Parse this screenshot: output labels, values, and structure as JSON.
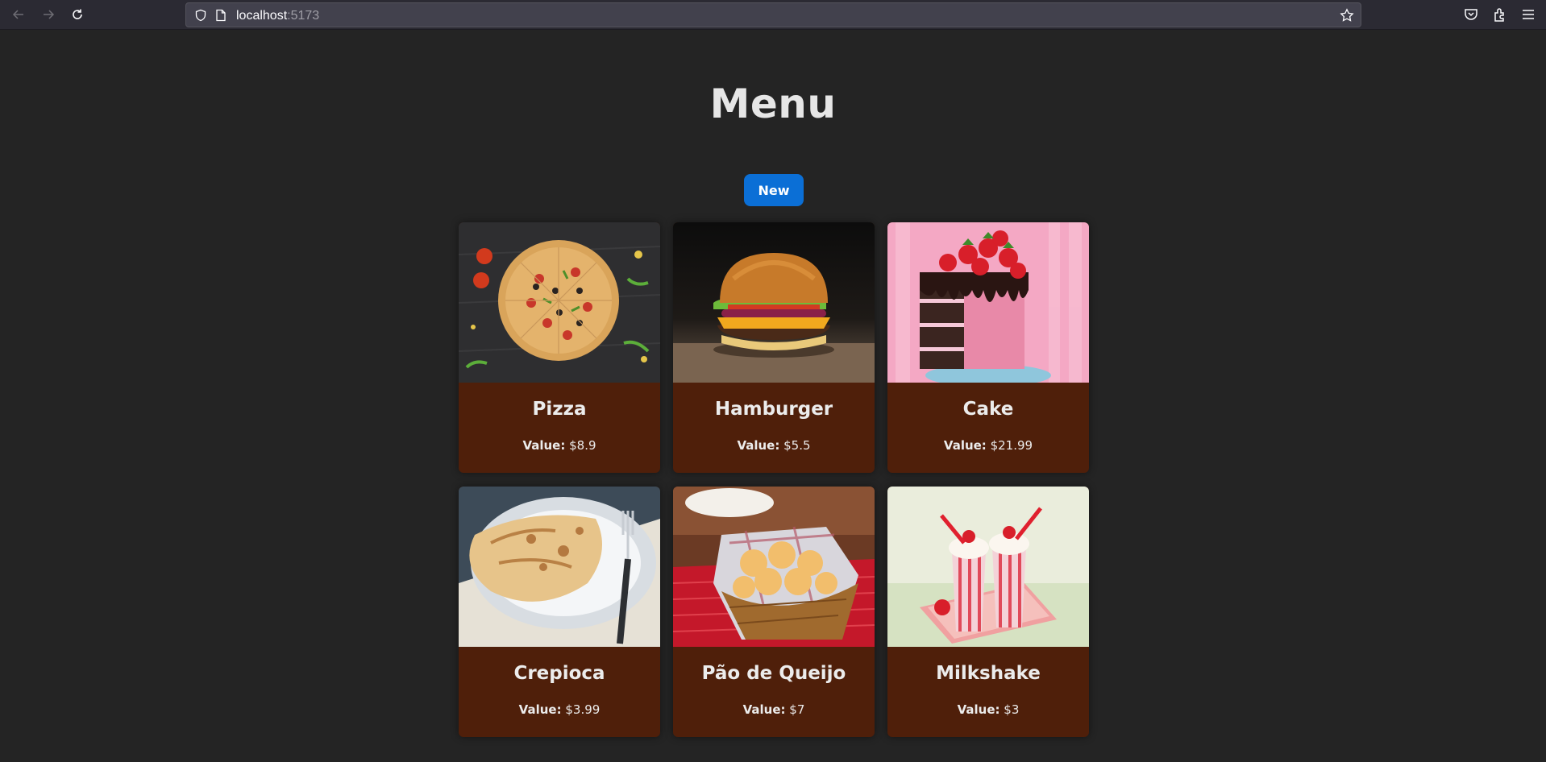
{
  "browser": {
    "url_host": "localhost",
    "url_port": ":5173",
    "icons": [
      "back-icon",
      "forward-icon",
      "reload-icon",
      "shield-icon",
      "page-icon",
      "star-icon",
      "pocket-icon",
      "extensions-icon",
      "menu-icon"
    ]
  },
  "page": {
    "title": "Menu",
    "new_button_label": "New",
    "value_label": "Value:"
  },
  "items": [
    {
      "name": "Pizza",
      "value": "$8.9",
      "image": "pizza"
    },
    {
      "name": "Hamburger",
      "value": "$5.5",
      "image": "hamburger"
    },
    {
      "name": "Cake",
      "value": "$21.99",
      "image": "cake"
    },
    {
      "name": "Crepioca",
      "value": "$3.99",
      "image": "crepioca"
    },
    {
      "name": "Pão de Queijo",
      "value": "$7",
      "image": "pao-de-queijo"
    },
    {
      "name": "Milkshake",
      "value": "$3",
      "image": "milkshake"
    }
  ],
  "colors": {
    "background": "#242424",
    "card": "#4f1f0a",
    "button": "#0b6fd6",
    "text": "#e6e6e6"
  }
}
